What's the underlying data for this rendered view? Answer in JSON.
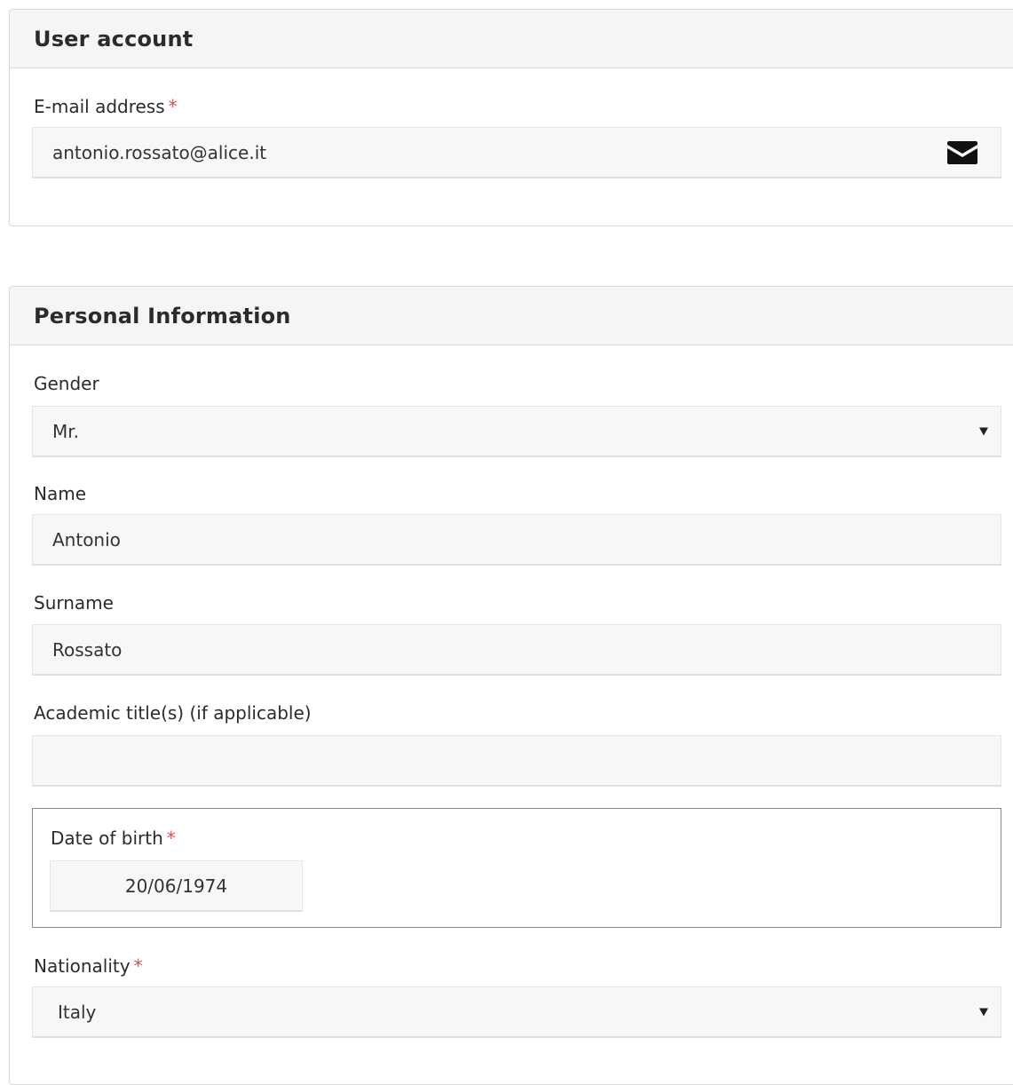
{
  "user_account": {
    "title": "User account",
    "email": {
      "label": "E-mail address",
      "required_mark": "*",
      "value": "antonio.rossato@alice.it",
      "icon": "envelope-icon"
    }
  },
  "personal_information": {
    "title": "Personal Information",
    "gender": {
      "label": "Gender",
      "selected": "Mr."
    },
    "name": {
      "label": "Name",
      "value": "Antonio"
    },
    "surname": {
      "label": "Surname",
      "value": "Rossato"
    },
    "academic_title": {
      "label": "Academic title(s) (if applicable)",
      "value": ""
    },
    "date_of_birth": {
      "label": "Date of birth",
      "required_mark": "*",
      "value": "20/06/1974"
    },
    "nationality": {
      "label": "Nationality",
      "required_mark": "*",
      "selected": "Italy"
    }
  },
  "colors": {
    "required": "#d9534f",
    "panel_header_bg": "#f5f5f5",
    "field_bg": "#f7f7f9"
  }
}
